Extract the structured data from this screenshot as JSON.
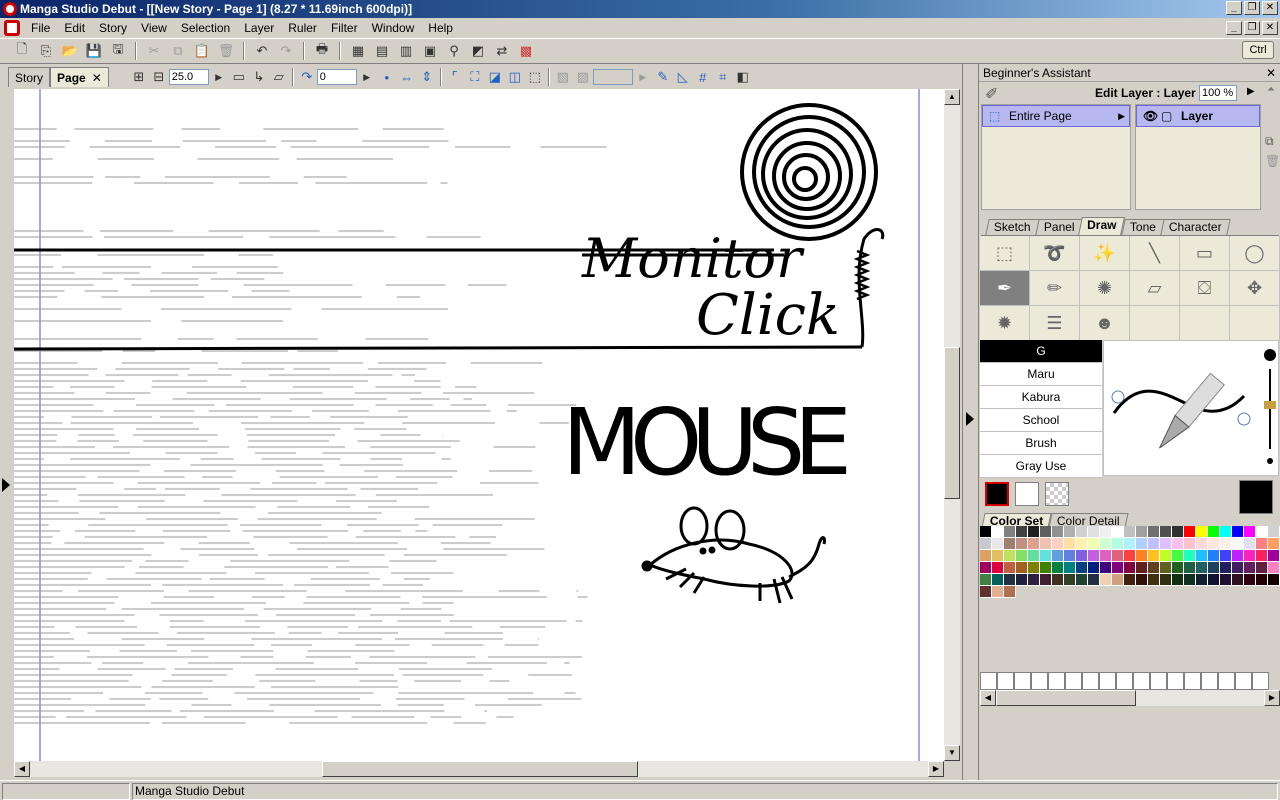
{
  "window": {
    "title": "Manga Studio Debut - [[New Story - Page 1] (8.27 * 11.69inch 600dpi)]",
    "minimize": "_",
    "restore": "❐",
    "close": "✕"
  },
  "menu": {
    "items": [
      "File",
      "Edit",
      "Story",
      "View",
      "Selection",
      "Layer",
      "Ruler",
      "Filter",
      "Window",
      "Help"
    ]
  },
  "toolbar": {
    "ctrl_label": "Ctrl"
  },
  "document": {
    "tabs": [
      {
        "label": "Story",
        "active": false
      },
      {
        "label": "Page",
        "active": true
      }
    ],
    "zoom_value": "25.0",
    "rotate_value": "0"
  },
  "canvas": {
    "drawings": {
      "text1": "Monitor",
      "text2": "Click",
      "text3": "MOUSE"
    }
  },
  "assistant": {
    "title": "Beginner's Assistant",
    "edit_layer_label": "Edit Layer : Layer",
    "opacity_value": "100 %",
    "scope_item": "Entire Page",
    "layer_item": "Layer",
    "tabs": [
      {
        "label": "Sketch",
        "active": false
      },
      {
        "label": "Panel",
        "active": false
      },
      {
        "label": "Draw",
        "active": true
      },
      {
        "label": "Tone",
        "active": false
      },
      {
        "label": "Character",
        "active": false
      }
    ],
    "pens": [
      {
        "label": "G",
        "active": true
      },
      {
        "label": "Maru",
        "active": false
      },
      {
        "label": "Kabura",
        "active": false
      },
      {
        "label": "School",
        "active": false
      },
      {
        "label": "Brush",
        "active": false
      },
      {
        "label": "Gray Use",
        "active": false
      }
    ],
    "color_tabs": [
      {
        "label": "Color Set",
        "active": true
      },
      {
        "label": "Color Detail",
        "active": false
      }
    ],
    "colors": {
      "main": "#000000",
      "sub": "#ffffff",
      "selected_swatch_border": "#d00000",
      "accent_selection": "#b8b8f0"
    }
  },
  "status": {
    "app_name": "Manga Studio Debut"
  }
}
